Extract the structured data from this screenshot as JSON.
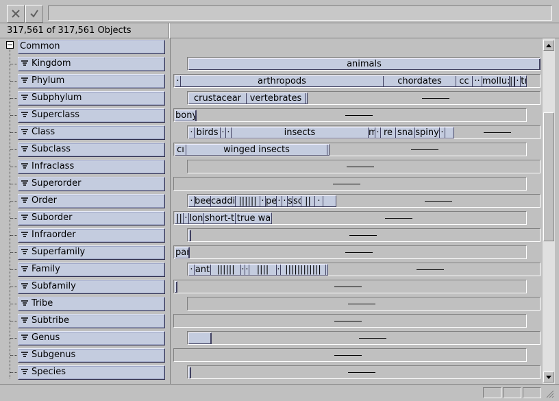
{
  "toolbar": {
    "cancel_icon": "x-icon",
    "confirm_icon": "check-icon",
    "command_value": ""
  },
  "count_text": "317,561 of 317,561 Objects",
  "tree_root": {
    "label": "Common",
    "icon": "minus-box-icon"
  },
  "ranks": [
    {
      "label": "Kingdom"
    },
    {
      "label": "Phylum"
    },
    {
      "label": "Subphylum"
    },
    {
      "label": "Superclass"
    },
    {
      "label": "Class"
    },
    {
      "label": "Subclass"
    },
    {
      "label": "Infraclass"
    },
    {
      "label": "Superorder"
    },
    {
      "label": "Order"
    },
    {
      "label": "Suborder"
    },
    {
      "label": "Infraorder"
    },
    {
      "label": "Superfamily"
    },
    {
      "label": "Family"
    },
    {
      "label": "Subfamily"
    },
    {
      "label": "Tribe"
    },
    {
      "label": "Subtribe"
    },
    {
      "label": "Genus"
    },
    {
      "label": "Subgenus"
    },
    {
      "label": "Species"
    }
  ],
  "segments": {
    "kingdom": [
      "animals"
    ],
    "phylum": [
      "·",
      "arthropods",
      "chordates",
      "cc",
      "··",
      "mollu:",
      "||",
      "·",
      "tr",
      "–"
    ],
    "subphylum": [
      "crustacear",
      "vertebrates"
    ],
    "superclass": [
      "bony"
    ],
    "class": [
      "·",
      "birds",
      "·",
      "·",
      "insects",
      "m",
      "·",
      "re",
      "sna",
      "spiny",
      "·"
    ],
    "subclass": [
      "cı",
      "winged insects"
    ],
    "order": [
      "·",
      "bee",
      "caddi",
      "||||||",
      "·",
      "pe",
      "·",
      "·",
      "s",
      "so",
      "||",
      "·"
    ],
    "suborder": [
      "||",
      "·",
      "lon",
      "short-t",
      "true wa",
      "·"
    ],
    "superfamily": [
      "par"
    ],
    "family": [
      "·",
      "ant",
      "||||||",
      "·",
      "·",
      "||||",
      "·",
      "||||||||||||"
    ]
  },
  "colors": {
    "bar_fill": "#c4ccdf",
    "chrome": "#c0c0c0"
  }
}
